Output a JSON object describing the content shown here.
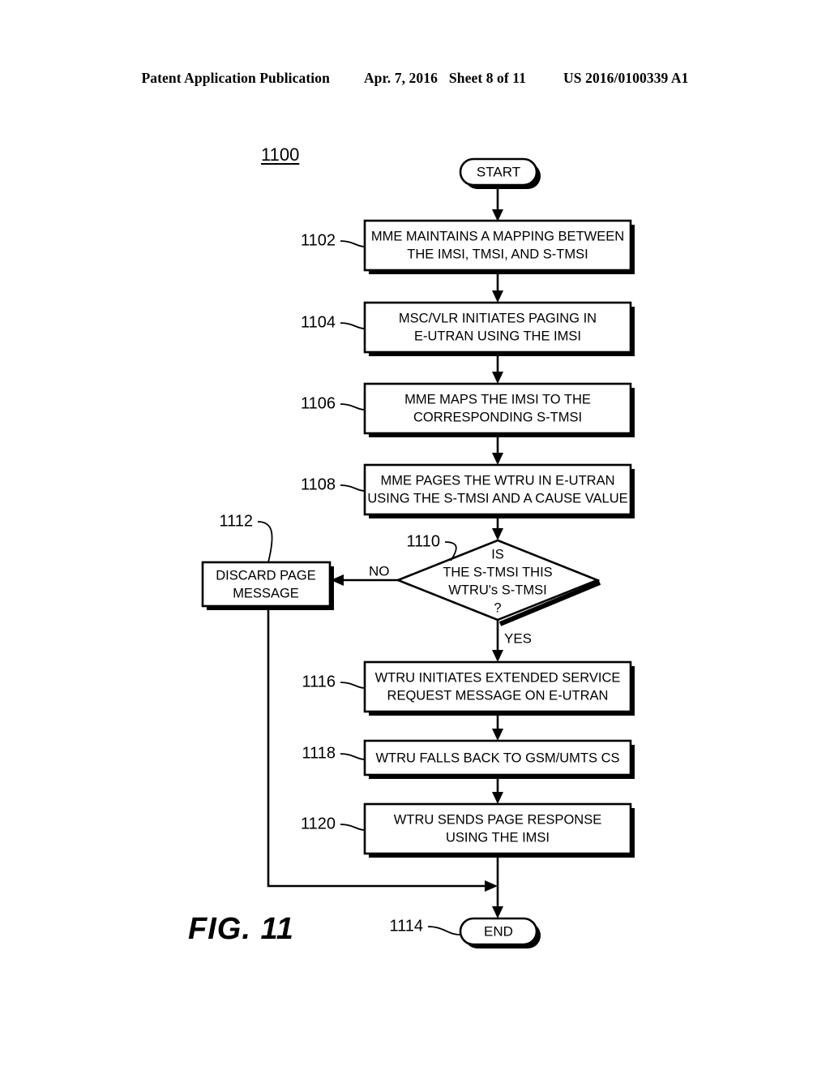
{
  "page": {
    "header": {
      "publication": "Patent Application Publication",
      "date": "Apr. 7, 2016",
      "sheet": "Sheet 8 of 11",
      "document_number": "US 2016/0100339 A1"
    },
    "figure_caption": "FIG. 11",
    "figure_number_label": "1100",
    "background_color": "#ffffff",
    "ink_color": "#000000"
  },
  "flowchart": {
    "title_ref": "1100",
    "terminators": [
      {
        "id": "start",
        "label": "START",
        "ref": ""
      },
      {
        "id": "end",
        "label": "END",
        "ref": "1114"
      }
    ],
    "steps": [
      {
        "ref": "1102",
        "lines": [
          "MME MAINTAINS A MAPPING BETWEEN",
          "THE IMSI, TMSI, AND S-TMSI"
        ]
      },
      {
        "ref": "1104",
        "lines": [
          "MSC/VLR INITIATES PAGING IN",
          "E-UTRAN USING THE IMSI"
        ]
      },
      {
        "ref": "1106",
        "lines": [
          "MME MAPS THE IMSI TO THE",
          "CORRESPONDING S-TMSI"
        ]
      },
      {
        "ref": "1108",
        "lines": [
          "MME PAGES THE WTRU IN E-UTRAN",
          "USING THE S-TMSI AND A CAUSE VALUE"
        ]
      },
      {
        "ref": "1116",
        "lines": [
          "WTRU INITIATES EXTENDED SERVICE",
          "REQUEST MESSAGE ON E-UTRAN"
        ]
      },
      {
        "ref": "1118",
        "lines": [
          "WTRU FALLS BACK TO GSM/UMTS CS"
        ]
      },
      {
        "ref": "1120",
        "lines": [
          "WTRU SENDS PAGE RESPONSE",
          "USING THE IMSI"
        ]
      }
    ],
    "decision": {
      "ref": "1110",
      "lines": [
        "IS",
        "THE S-TMSI THIS",
        "WTRU's S-TMSI",
        "?"
      ],
      "branches": [
        {
          "label": "NO",
          "target_ref": "1112"
        },
        {
          "label": "YES",
          "target_ref": "1116"
        }
      ]
    },
    "discard_node": {
      "ref": "1112",
      "lines": [
        "DISCARD PAGE",
        "MESSAGE"
      ]
    }
  }
}
